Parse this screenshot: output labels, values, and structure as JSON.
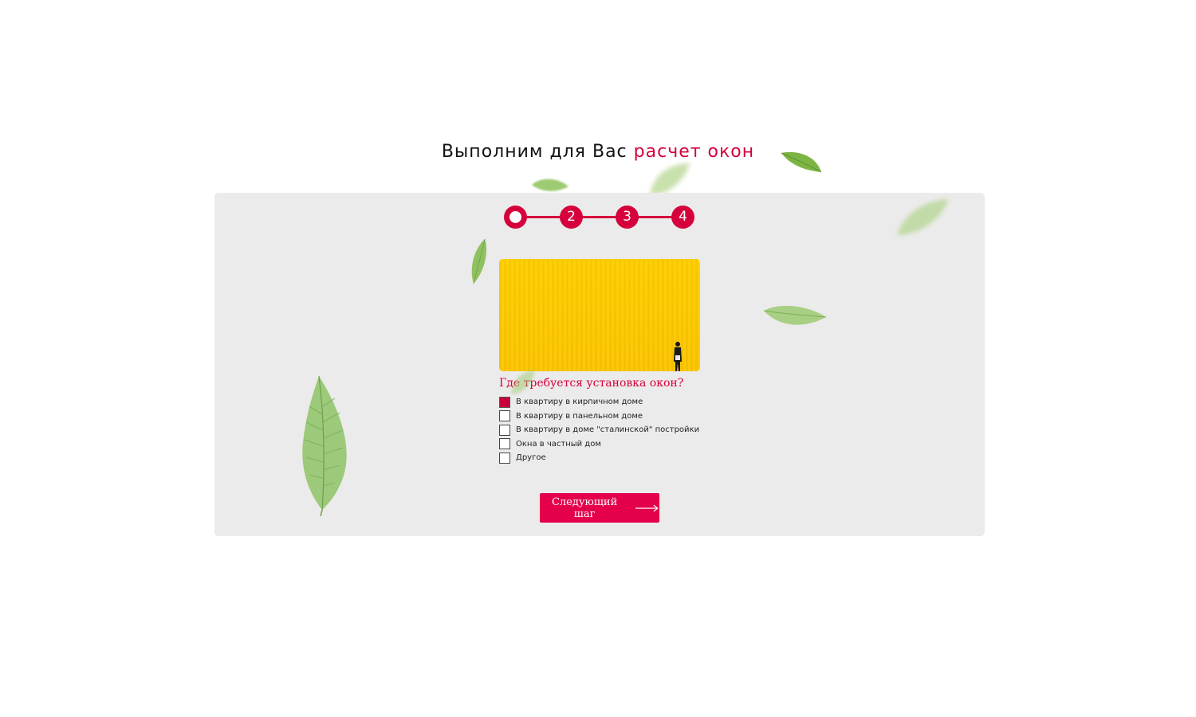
{
  "heading": {
    "main": "Выполним для Вас",
    "accent": "расчет окон"
  },
  "stepper": {
    "current_step": 1,
    "steps": [
      "",
      "2",
      "3",
      "4"
    ]
  },
  "quiz": {
    "question": "Где требуется установка окон?",
    "options": [
      {
        "label": "В квартиру в кирпичном доме",
        "checked": true
      },
      {
        "label": "В квартиру в панельном доме",
        "checked": false
      },
      {
        "label": "В квартиру в доме \"сталинской\" постройки",
        "checked": false
      },
      {
        "label": "Окна в частный дом",
        "checked": false
      },
      {
        "label": "Другое",
        "checked": false
      }
    ]
  },
  "next_button": {
    "label": "Следующий шаг",
    "icon": "arrow-right-icon"
  },
  "colors": {
    "accent": "#d6003c",
    "button": "#e4004a",
    "panel": "#ebebeb",
    "photo": "#ffcd0a"
  }
}
